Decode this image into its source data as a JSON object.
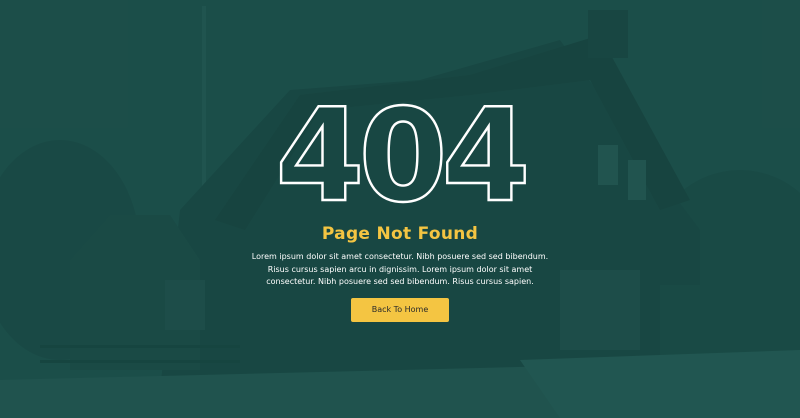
{
  "error": {
    "code": "404",
    "title": "Page Not Found",
    "description": "Lorem ipsum dolor sit amet consectetur. Nibh posuere sed sed bibendum. Risus cursus sapien arcu in dignissim. Lorem ipsum dolor sit amet consectetur. Nibh posuere sed sed bibendum. Risus cursus sapien."
  },
  "actions": {
    "back_home_label": "Back To Home"
  },
  "colors": {
    "overlay": "#1f524d",
    "accent": "#f4c542",
    "text": "#ffffff"
  },
  "background": {
    "icon": "house-photo"
  }
}
